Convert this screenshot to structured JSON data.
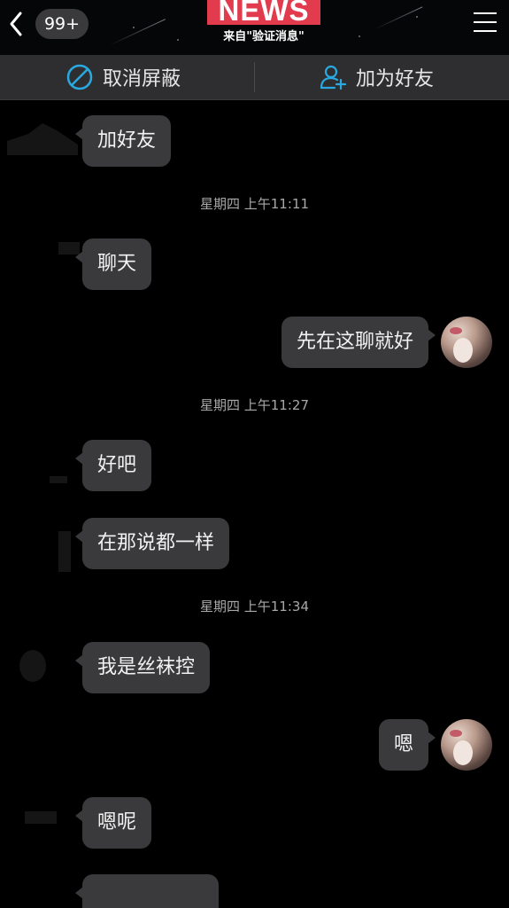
{
  "header": {
    "unread_badge": "99+",
    "title": "NEWS",
    "subtitle": "来自\"验证消息\""
  },
  "action_bar": {
    "unblock_label": "取消屏蔽",
    "add_friend_label": "加为好友"
  },
  "messages": [
    {
      "side": "in",
      "text": "加好友"
    },
    {
      "side": "time",
      "text": "星期四 上午11:11"
    },
    {
      "side": "in",
      "text": "聊天"
    },
    {
      "side": "out",
      "text": "先在这聊就好"
    },
    {
      "side": "time",
      "text": "星期四 上午11:27"
    },
    {
      "side": "in",
      "text": "好吧"
    },
    {
      "side": "in",
      "text": "在那说都一样"
    },
    {
      "side": "time",
      "text": "星期四 上午11:34"
    },
    {
      "side": "in",
      "text": "我是丝袜控"
    },
    {
      "side": "out",
      "text": "嗯"
    },
    {
      "side": "in",
      "text": "嗯呢"
    }
  ],
  "colors": {
    "background": "#000000",
    "bubble": "#3a3a3c",
    "action_bar": "#2e2e30",
    "accent_icon": "#29a9e0",
    "news_red": "#e23b4e"
  }
}
